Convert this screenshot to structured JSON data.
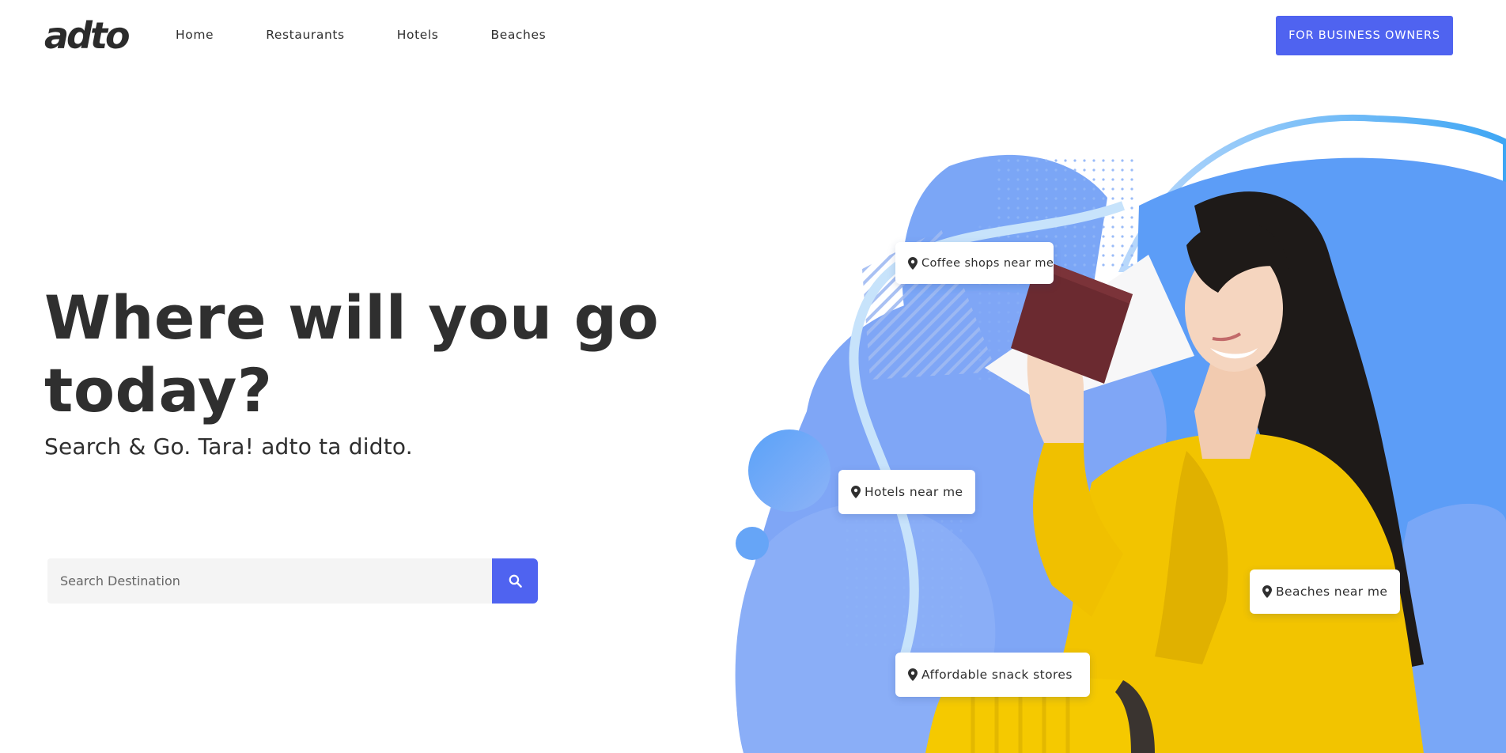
{
  "brand": {
    "logo_text": "adto"
  },
  "nav": {
    "items": [
      "Home",
      "Restaurants",
      "Hotels",
      "Beaches"
    ]
  },
  "header": {
    "cta_label": "FOR BUSINESS OWNERS"
  },
  "hero": {
    "headline": "Where will you go today?",
    "subline": "Search & Go. Tara! adto ta didto."
  },
  "search": {
    "placeholder": "Search Destination",
    "icon": "search-icon"
  },
  "chips": [
    {
      "label": "Coffee shops near me",
      "icon": "map-pin-icon"
    },
    {
      "label": "Hotels near me",
      "icon": "map-pin-icon"
    },
    {
      "label": "Beaches near me",
      "icon": "map-pin-icon"
    },
    {
      "label": "Affordable snack stores",
      "icon": "map-pin-icon"
    }
  ],
  "colors": {
    "accent": "#4f63f0",
    "blob_blue": "#6fa3f7",
    "jacket_yellow": "#f2c400",
    "text_dark": "#2f2f2f"
  }
}
